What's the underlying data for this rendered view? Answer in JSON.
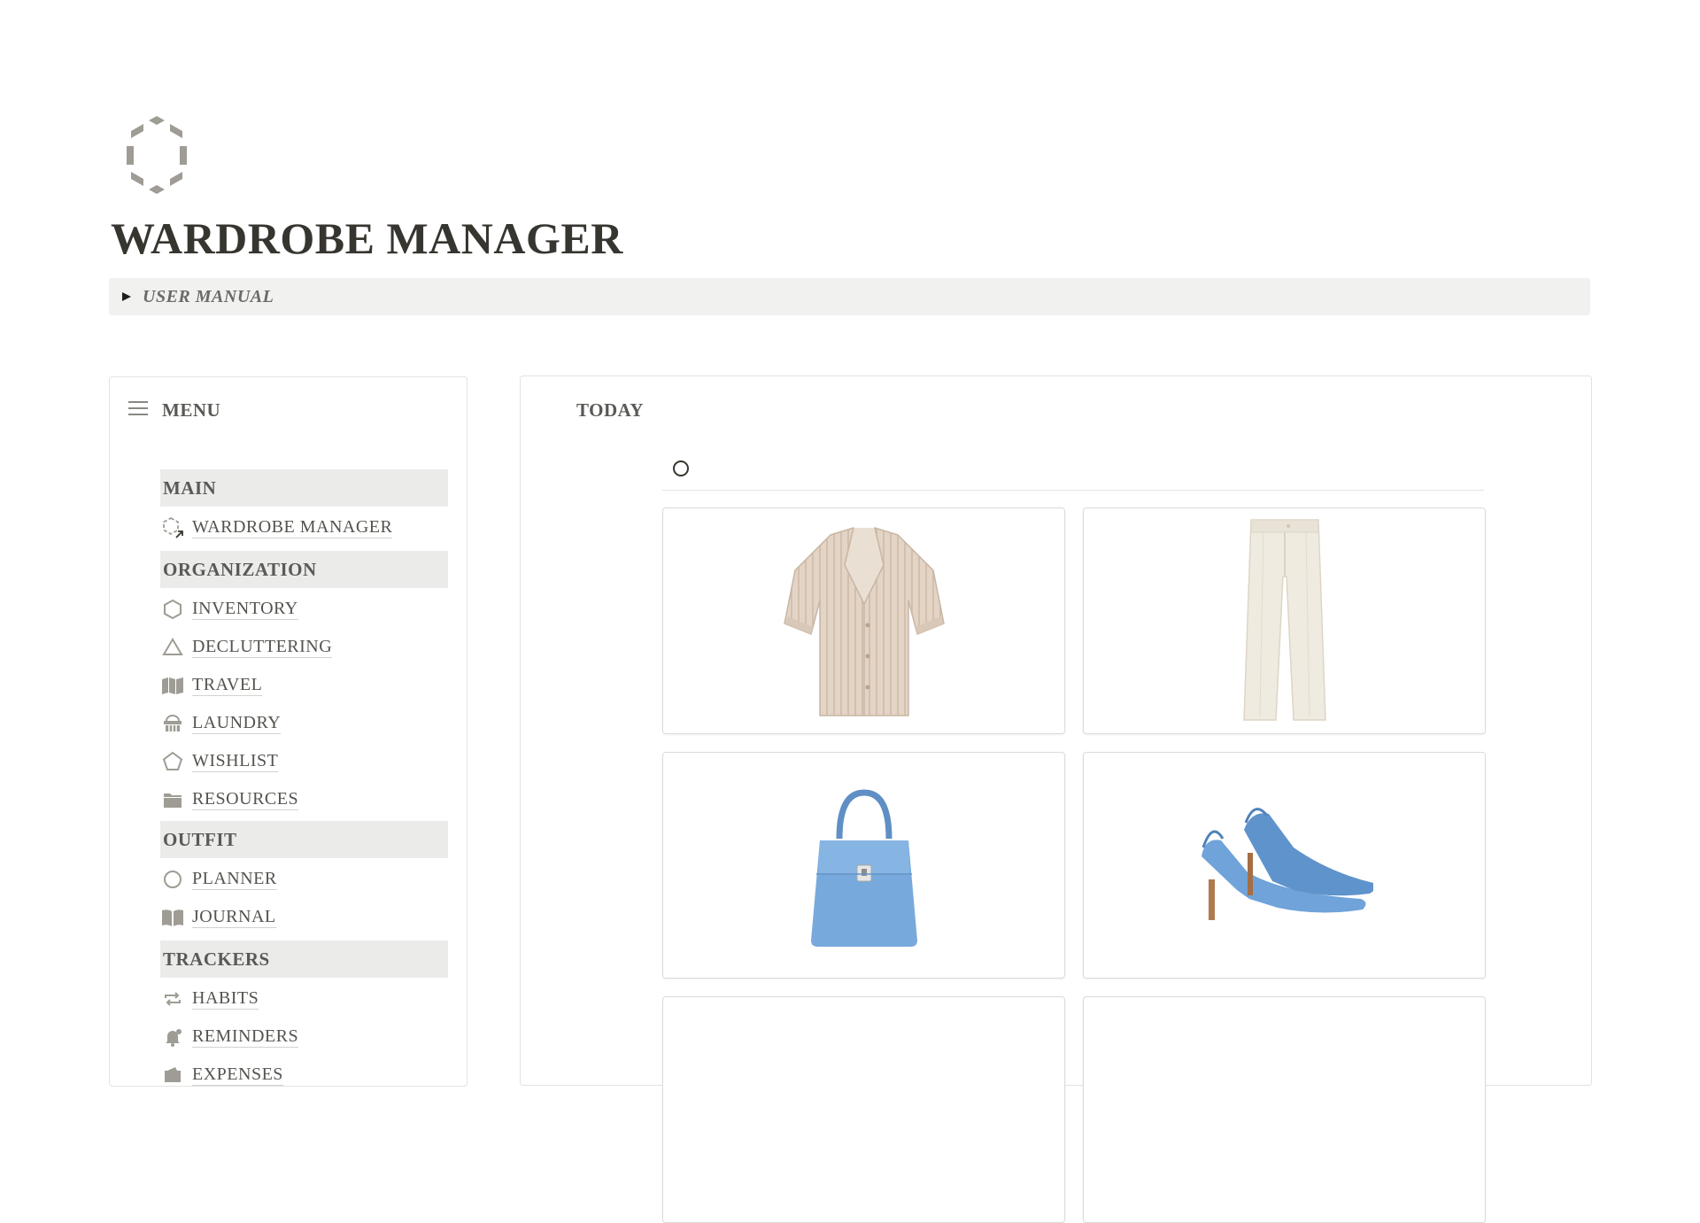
{
  "page": {
    "title": "WARDROBE MANAGER",
    "icon": "hexagon-dashed-icon"
  },
  "user_manual": {
    "label": "USER MANUAL",
    "icon": "triangle-right-icon"
  },
  "menu": {
    "title": "MENU",
    "icon": "hamburger-icon",
    "sections": [
      {
        "label": "MAIN",
        "items": [
          {
            "label": "WARDROBE MANAGER",
            "icon": "hexagon-link-icon"
          }
        ]
      },
      {
        "label": "ORGANIZATION",
        "items": [
          {
            "label": "INVENTORY",
            "icon": "hexagon-icon"
          },
          {
            "label": "DECLUTTERING",
            "icon": "triangle-icon"
          },
          {
            "label": "TRAVEL",
            "icon": "map-icon"
          },
          {
            "label": "LAUNDRY",
            "icon": "basket-icon"
          },
          {
            "label": "WISHLIST",
            "icon": "pentagon-icon"
          },
          {
            "label": "RESOURCES",
            "icon": "folder-icon"
          }
        ]
      },
      {
        "label": "OUTFIT",
        "items": [
          {
            "label": "PLANNER",
            "icon": "circle-icon"
          },
          {
            "label": "JOURNAL",
            "icon": "book-icon"
          }
        ]
      },
      {
        "label": "TRACKERS",
        "items": [
          {
            "label": "HABITS",
            "icon": "repeat-icon"
          },
          {
            "label": "REMINDERS",
            "icon": "bell-icon"
          },
          {
            "label": "EXPENSES",
            "icon": "wallet-icon"
          }
        ]
      }
    ]
  },
  "today": {
    "title": "TODAY",
    "view_icon": "circle-outline-icon",
    "gallery": [
      {
        "name": "blouse-card",
        "image": "beige-blouse"
      },
      {
        "name": "trousers-card",
        "image": "cream-trousers"
      },
      {
        "name": "handbag-card",
        "image": "blue-handbag"
      },
      {
        "name": "heels-card",
        "image": "blue-slingback-heels"
      },
      {
        "name": "card-5",
        "image": ""
      },
      {
        "name": "card-6",
        "image": ""
      }
    ]
  },
  "colors": {
    "text": "#37352f",
    "section_bg": "#ebebea",
    "toggle_bg": "#f1f1ef",
    "icon_gray": "#a09e98",
    "accent_blue": "#6fa3d9"
  }
}
